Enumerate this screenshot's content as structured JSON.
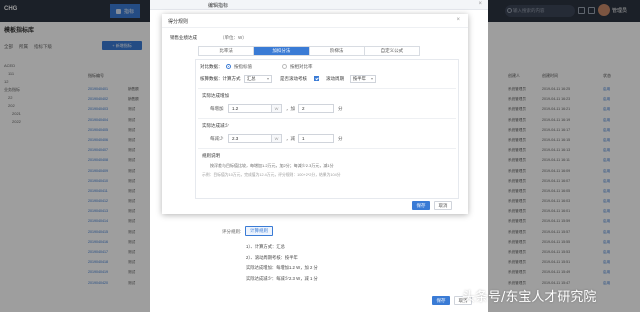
{
  "app": {
    "logo": "CHG",
    "nav_active": "指标",
    "search_placeholder": "输入搜索的内容",
    "username": "管理员"
  },
  "left": {
    "breadcrumb": "模板指标库",
    "toolbar": [
      "全部",
      "所属",
      "指标下级"
    ],
    "add_button": "+ 新增指标",
    "tree": [
      "ACED",
      "111",
      "12",
      "业务指标",
      "22",
      "202",
      "2021",
      "2022"
    ],
    "col_code": "指标编号",
    "codes": [
      "2019040401",
      "2019040402",
      "2019040403",
      "2019040404",
      "2019040405",
      "2019040406",
      "2019040407",
      "2019040408",
      "2019040409",
      "2019040410",
      "2019040411",
      "2019040412",
      "2019040413",
      "2019040414",
      "2019040415",
      "2019040416",
      "2019040417",
      "2019040418",
      "2019040419",
      "2019040420"
    ],
    "names": [
      "销售额",
      "销售额",
      "测试",
      "测试",
      "测试",
      "测试",
      "测试",
      "测试",
      "测试",
      "测试",
      "测试",
      "测试",
      "测试",
      "测试",
      "测试",
      "测试",
      "测试",
      "测试",
      "测试",
      "测试"
    ]
  },
  "right": {
    "col_person": "创建人",
    "col_time": "创建时间",
    "col_status": "状态",
    "persons": [
      "系统管理员",
      "系统管理员",
      "系统管理员",
      "系统管理员",
      "系统管理员",
      "系统管理员",
      "系统管理员",
      "系统管理员",
      "系统管理员",
      "系统管理员",
      "系统管理员",
      "系统管理员",
      "系统管理员",
      "系统管理员",
      "系统管理员",
      "系统管理员",
      "系统管理员",
      "系统管理员",
      "系统管理员",
      "系统管理员"
    ],
    "times": [
      "2019-04-11 16:25",
      "2019-04-11 16:23",
      "2019-04-11 16:21",
      "2019-04-11 16:19",
      "2019-04-11 16:17",
      "2019-04-11 16:15",
      "2019-04-11 16:13",
      "2019-04-11 16:11",
      "2019-04-11 16:09",
      "2019-04-11 16:07",
      "2019-04-11 16:05",
      "2019-04-11 16:03",
      "2019-04-11 16:01",
      "2019-04-11 15:59",
      "2019-04-11 15:57",
      "2019-04-11 15:55",
      "2019-04-11 15:53",
      "2019-04-11 15:51",
      "2019-04-11 15:49",
      "2019-04-11 15:47"
    ],
    "statuses": [
      "启用",
      "启用",
      "启用",
      "启用",
      "启用",
      "启用",
      "启用",
      "启用",
      "启用",
      "启用",
      "启用",
      "启用",
      "启用",
      "启用",
      "启用",
      "启用",
      "启用",
      "启用",
      "启用",
      "启用"
    ]
  },
  "outer": {
    "title": "编辑指标",
    "side_labels": [
      "基本",
      "评分",
      "取值",
      "其他"
    ],
    "summary_label": "评分规则:",
    "summary_button": "计算规则",
    "summary_lines": [
      "1）、计算方式：汇总",
      "2）、滚动周期考核：按半年",
      "实际达成增加：每增加1.2 W，加 2 分",
      "实际达成减少：每减少2.3 W，减 1 分"
    ],
    "section_label": "评分规则",
    "save": "保存",
    "cancel": "取消"
  },
  "inner": {
    "title": "得分规则",
    "field_label": "销售业绩达成",
    "unit": "（单位：W）",
    "tabs": [
      "比率法",
      "加扣分法",
      "阶梯法",
      "自定义公式"
    ],
    "compare_label": "对比数据：",
    "radio_opts": [
      "按指标值",
      "按相对比率"
    ],
    "calc_label": "核算数据：计算方式",
    "calc_select": "汇总",
    "rolling_label": "是否滚动考核",
    "period_label": "滚动周期",
    "period_select": "按半年",
    "inc_title": "实际达成增加",
    "inc_each": "每增加",
    "inc_value": "1.2",
    "inc_unit": "W",
    "inc_plus": "，加",
    "inc_score": "2",
    "inc_fen": "分",
    "dec_title": "实际达成减少",
    "dec_each": "每减少",
    "dec_value": "2.3",
    "dec_unit": "W",
    "dec_minus": "，减",
    "dec_score": "1",
    "dec_fen": "分",
    "rule_title": "规则说明",
    "rule_text": "按浮差与目标值比较，每增加1.2万元，加2分；每减少2.3万元，减1分",
    "rule_example": "示例：目标值为10万元，完成值为12.4万元，评分规则：100+2*2分，结果为104分",
    "save": "保存",
    "cancel": "取消"
  },
  "watermark": "头条号/东宝人才研究院",
  "colors": {
    "primary": "#3a7bd5",
    "topbar": "#2d3442"
  }
}
